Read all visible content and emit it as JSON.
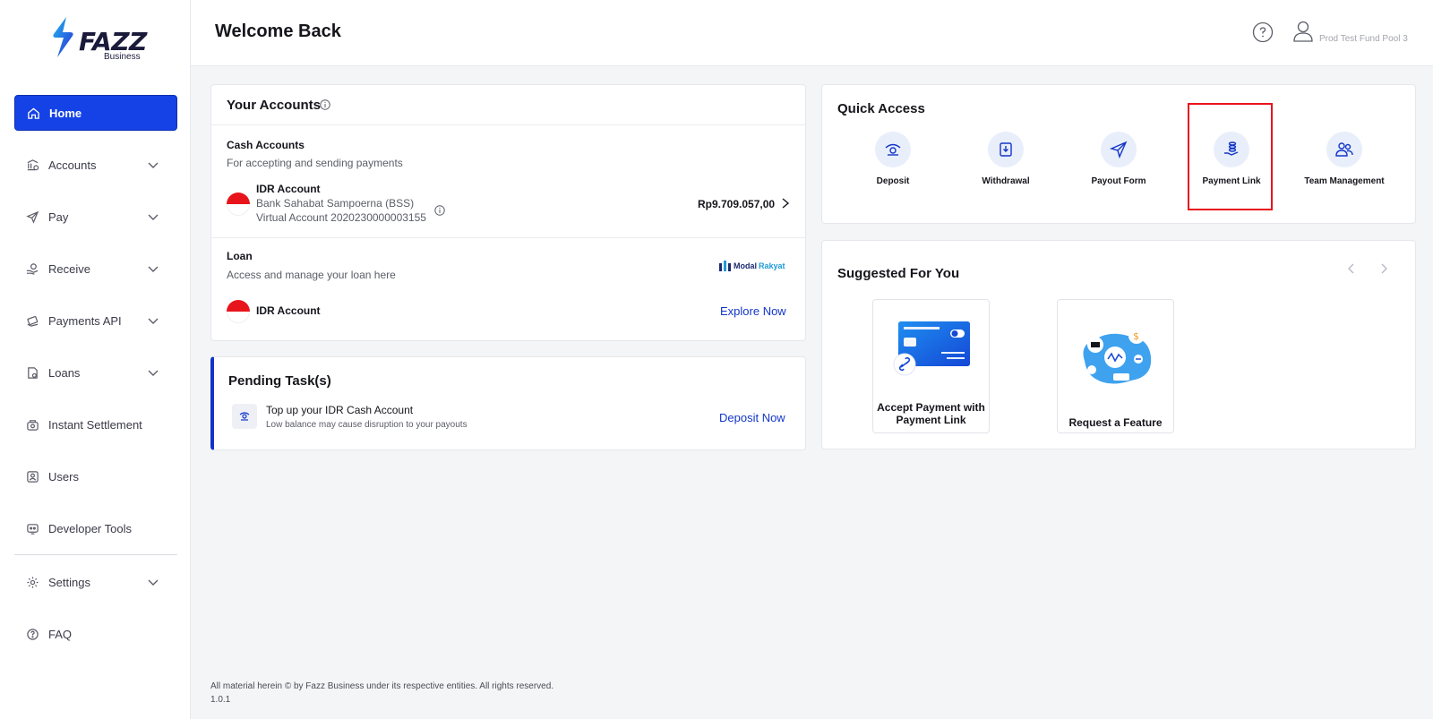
{
  "brand": {
    "name": "FAZZ",
    "sub": "Business",
    "accent": "#1542e6"
  },
  "sidebar": {
    "items": [
      {
        "label": "Home",
        "icon": "home-icon",
        "active": true,
        "expandable": false
      },
      {
        "label": "Accounts",
        "icon": "bank-icon",
        "expandable": true
      },
      {
        "label": "Pay",
        "icon": "send-icon",
        "expandable": true
      },
      {
        "label": "Receive",
        "icon": "receive-icon",
        "expandable": true
      },
      {
        "label": "Payments API",
        "icon": "api-icon",
        "expandable": true
      },
      {
        "label": "Loans",
        "icon": "loan-icon",
        "expandable": true
      },
      {
        "label": "Instant Settlement",
        "icon": "settlement-icon",
        "expandable": false
      },
      {
        "label": "Users",
        "icon": "users-icon",
        "expandable": false
      },
      {
        "label": "Developer Tools",
        "icon": "developer-icon",
        "expandable": false
      },
      {
        "label": "Settings",
        "icon": "gear-icon",
        "expandable": true
      },
      {
        "label": "FAQ",
        "icon": "question-icon",
        "expandable": false
      }
    ]
  },
  "header": {
    "title": "Welcome Back",
    "user_name": "Prod Test Fund Pool 3"
  },
  "accounts": {
    "title": "Your Accounts",
    "cash": {
      "title": "Cash Accounts",
      "description": "For accepting and sending payments",
      "account_name": "IDR Account",
      "bank": "Bank Sahabat Sampoerna (BSS)",
      "virtual_account": "Virtual Account 2020230000003155",
      "balance": "Rp9.709.057,00"
    },
    "loan": {
      "title": "Loan",
      "description": "Access and manage your loan here",
      "partner_logo_1": "Modal",
      "partner_logo_2": "Rakyat",
      "account_name": "IDR Account",
      "cta": "Explore Now"
    }
  },
  "pending": {
    "title": "Pending Task(s)",
    "task_title": "Top up your IDR Cash Account",
    "task_subtitle": "Low balance may cause disruption to your payouts",
    "cta": "Deposit Now"
  },
  "quick_access": {
    "title": "Quick Access",
    "items": [
      {
        "label": "Deposit",
        "icon": "deposit-icon"
      },
      {
        "label": "Withdrawal",
        "icon": "withdrawal-icon"
      },
      {
        "label": "Payout Form",
        "icon": "paper-plane-icon"
      },
      {
        "label": "Payment Link",
        "icon": "coins-hand-icon"
      },
      {
        "label": "Team Management",
        "icon": "team-icon"
      }
    ],
    "highlight_color": "#e8141c"
  },
  "suggested": {
    "title": "Suggested For You",
    "cards": [
      {
        "label": "Accept Payment with Payment Link"
      },
      {
        "label": "Request a Feature"
      }
    ]
  },
  "footer": {
    "copyright": "All material herein © by Fazz Business under its respective entities. All rights reserved.",
    "version": "1.0.1"
  }
}
